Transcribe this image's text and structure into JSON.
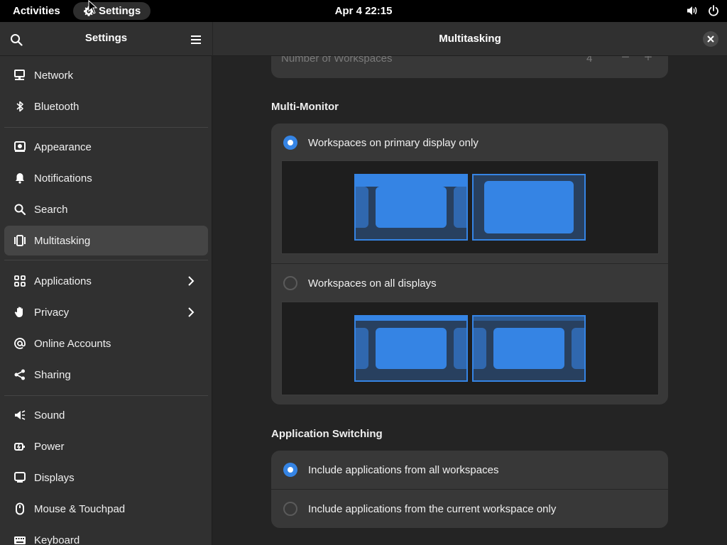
{
  "topbar": {
    "activities": "Activities",
    "app_menu": "Settings",
    "clock": "Apr 4  22:15",
    "icons": [
      "volume-icon",
      "power-icon"
    ]
  },
  "sidebar": {
    "title": "Settings",
    "items": [
      {
        "label": "Network",
        "icon": "network-icon"
      },
      {
        "label": "Bluetooth",
        "icon": "bluetooth-icon"
      },
      {
        "label": "Appearance",
        "icon": "appearance-icon"
      },
      {
        "label": "Notifications",
        "icon": "bell-icon"
      },
      {
        "label": "Search",
        "icon": "search-icon"
      },
      {
        "label": "Multitasking",
        "icon": "multitasking-icon",
        "active": true
      },
      {
        "label": "Applications",
        "icon": "apps-grid-icon",
        "submenu": true
      },
      {
        "label": "Privacy",
        "icon": "hand-icon",
        "submenu": true
      },
      {
        "label": "Online Accounts",
        "icon": "at-icon"
      },
      {
        "label": "Sharing",
        "icon": "share-icon"
      },
      {
        "label": "Sound",
        "icon": "speaker-icon"
      },
      {
        "label": "Power",
        "icon": "power-plug-icon"
      },
      {
        "label": "Displays",
        "icon": "display-icon"
      },
      {
        "label": "Mouse & Touchpad",
        "icon": "mouse-icon"
      },
      {
        "label": "Keyboard",
        "icon": "keyboard-icon"
      }
    ]
  },
  "main": {
    "title": "Multitasking",
    "workspaces": {
      "label": "Number of Workspaces",
      "value": "4",
      "minus": "−",
      "plus": "+"
    },
    "multi_monitor": {
      "title": "Multi-Monitor",
      "options": [
        {
          "label": "Workspaces on primary display only",
          "selected": true
        },
        {
          "label": "Workspaces on all displays",
          "selected": false
        }
      ]
    },
    "app_switching": {
      "title": "Application Switching",
      "options": [
        {
          "label": "Include applications from all workspaces",
          "selected": true
        },
        {
          "label": "Include applications from the current workspace only",
          "selected": false
        }
      ]
    }
  },
  "colors": {
    "accent": "#3584e4",
    "topbar": "#000000",
    "sidebar": "#303030",
    "content": "#242424",
    "card": "#383838"
  }
}
